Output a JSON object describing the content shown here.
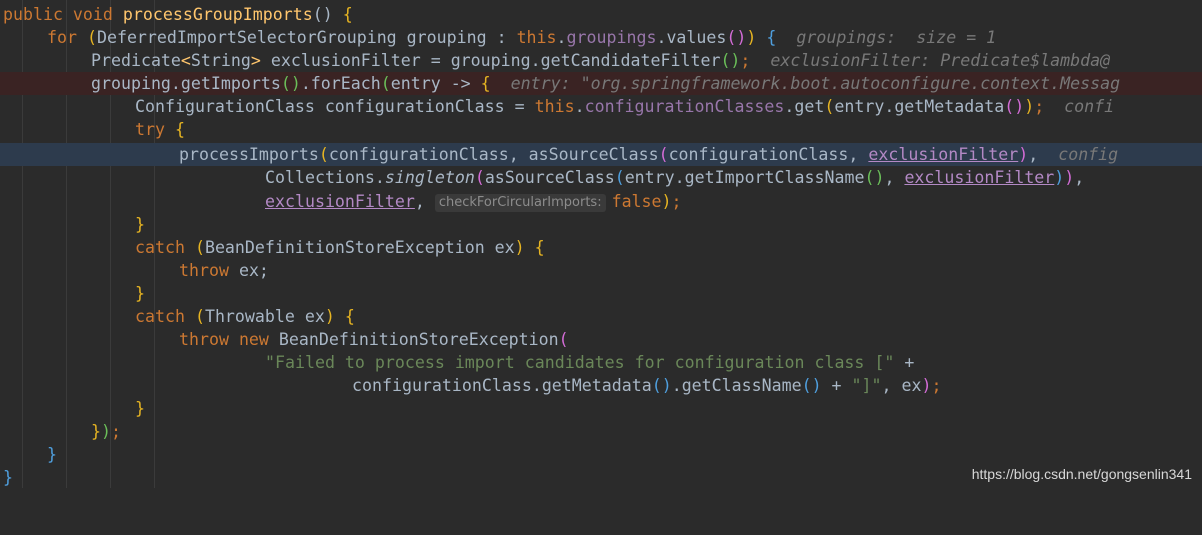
{
  "code": {
    "l1": {
      "kw": "public void ",
      "fn": "processGroupImports",
      "paren": "() ",
      "brace": "{"
    },
    "l2": {
      "kw_for": "for ",
      "p1": "(",
      "type": "DeferredImportSelectorGrouping grouping : ",
      "this": "this",
      "dot": ".",
      "field": "groupings",
      "call": ".values",
      "pc": "()",
      "p2": ")",
      "sp": " ",
      "brace": "{",
      "hint": "  groupings:  size = 1"
    },
    "l3": {
      "type": "Predicate",
      "gen_open": "<",
      "gen_type": "String",
      "gen_close": ">",
      "rest": " exclusionFilter = grouping.getCandidateFilter",
      "pc": "()",
      "semi": ";",
      "hint": "  exclusionFilter: Predicate$lambda@"
    },
    "l4": {
      "a": "grouping.getImports",
      "pc": "()",
      "b": ".forEach",
      "p": "(",
      "c": "entry -> ",
      "brace": "{",
      "hint": "  entry: \"org.springframework.boot.autoconfigure.context.Messag"
    },
    "l5": {
      "a": "ConfigurationClass configurationClass = ",
      "this": "this",
      "dot": ".",
      "field": "configurationClasses",
      "b": ".get",
      "p1": "(",
      "c": "entry.getMetadata",
      "pc": "()",
      "p2": ")",
      "semi": ";",
      "hint": "  confi"
    },
    "l6": {
      "kw": "try ",
      "brace": "{"
    },
    "l7": {
      "a": "processImports",
      "p1": "(",
      "b": "configurationClass, asSourceClass",
      "p2": "(",
      "c": "configurationClass, ",
      "field": "exclusionFilter",
      "p3": ")",
      "d": ",",
      "hint": "  config"
    },
    "l8": {
      "a": "Collections.",
      "it": "singleton",
      "p1": "(",
      "b": "asSourceClass",
      "p2": "(",
      "c": "entry.getImportClassName",
      "pc": "()",
      "d": ", ",
      "field": "exclusionFilter",
      "p3": ")",
      "p4": ")",
      "e": ","
    },
    "l9": {
      "field": "exclusionFilter",
      "comma": ", ",
      "param": "checkForCircularImports:",
      "kw": "false",
      "p": ")",
      "semi": ";"
    },
    "l10": {
      "brace": "}"
    },
    "l11": {
      "kw": "catch ",
      "p1": "(",
      "a": "BeanDefinitionStoreException ex",
      "p2": ")",
      "sp": " ",
      "brace": "{"
    },
    "l12": {
      "kw": "throw ",
      "a": "ex;"
    },
    "l13": {
      "brace": "}"
    },
    "l14": {
      "kw": "catch ",
      "p1": "(",
      "a": "Throwable ex",
      "p2": ")",
      "sp": " ",
      "brace": "{"
    },
    "l15": {
      "kw": "throw new ",
      "a": "BeanDefinitionStoreException",
      "p": "("
    },
    "l16": {
      "str": "\"Failed to process import candidates for configuration class [\"",
      "a": " +"
    },
    "l17": {
      "a": "configurationClass.getMetadata",
      "pc1": "()",
      "b": ".getClassName",
      "pc2": "()",
      "c": " + ",
      "str": "\"]\"",
      "d": ", ex",
      "p": ")",
      "semi": ";"
    },
    "l18": {
      "brace": "}"
    },
    "l19": {
      "brace": "}",
      "p": ")",
      "semi": ";"
    },
    "l20": {
      "brace": "}"
    },
    "l21": {
      "brace": "}"
    }
  },
  "watermark": "https://blog.csdn.net/gongsenlin341",
  "colors": {
    "background": "#2b2b2b",
    "keyword": "#cc7832",
    "method": "#ffc66d",
    "field": "#9876aa",
    "string": "#6a8759",
    "breakpoint_line": "#3a2323",
    "current_line": "#2d3b4d"
  }
}
